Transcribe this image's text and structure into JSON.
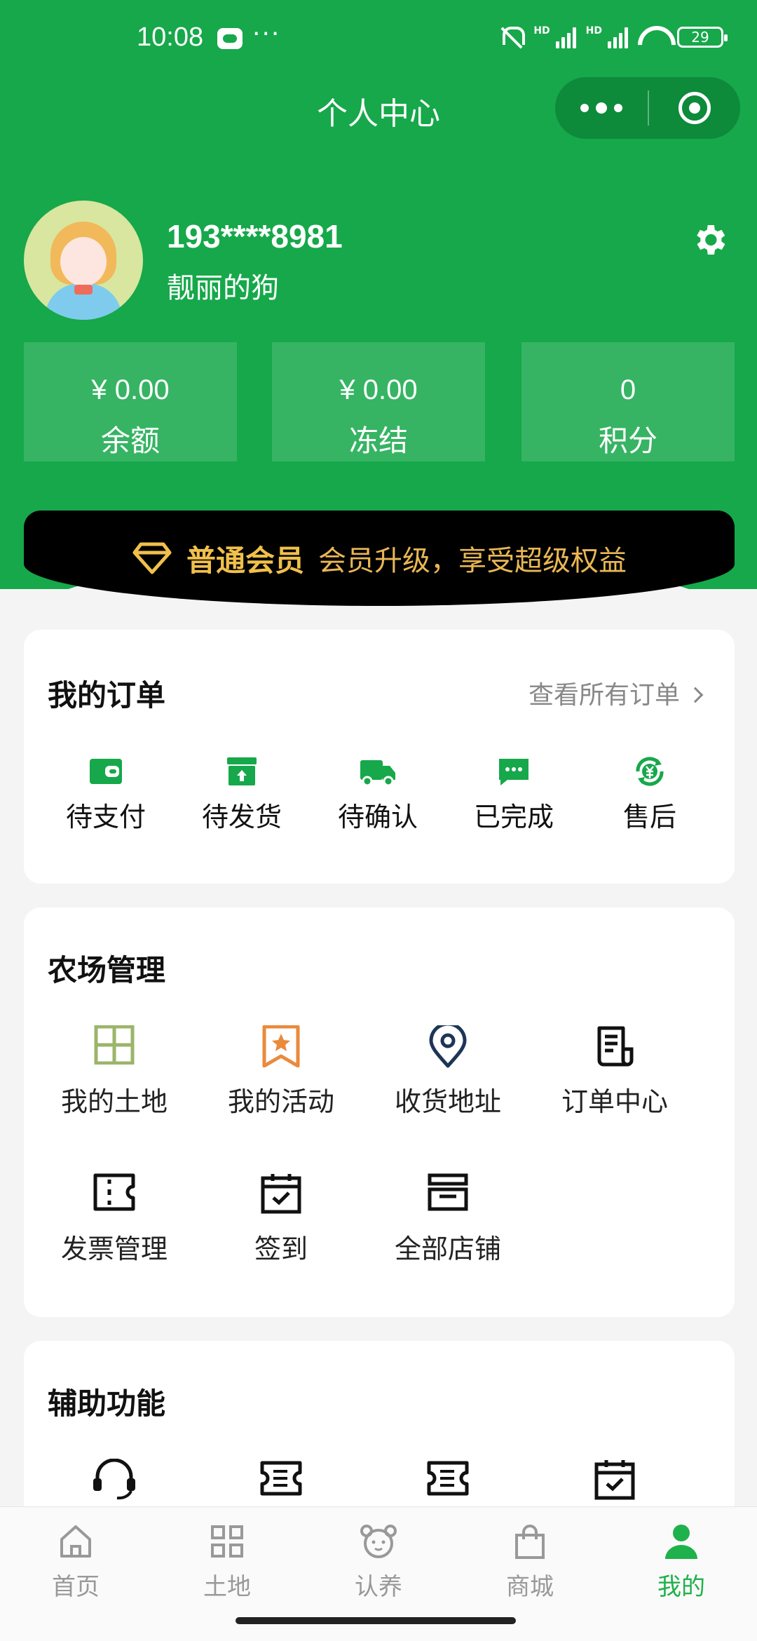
{
  "status_bar": {
    "time": "10:08",
    "dots": "···",
    "hd1": "HD",
    "hd2": "HD",
    "battery": "29"
  },
  "nav": {
    "title": "个人中心"
  },
  "profile": {
    "phone": "193****8981",
    "nickname": "靓丽的狗"
  },
  "stats": [
    {
      "value": "¥ 0.00",
      "label": "余额"
    },
    {
      "value": "¥ 0.00",
      "label": "冻结"
    },
    {
      "value": "0",
      "label": "积分"
    }
  ],
  "vip": {
    "tier": "普通会员",
    "promo": "会员升级，享受超级权益"
  },
  "orders": {
    "title": "我的订单",
    "view_all": "查看所有订单",
    "items": [
      {
        "label": "待支付",
        "icon": "wallet-icon"
      },
      {
        "label": "待发货",
        "icon": "box-icon"
      },
      {
        "label": "待确认",
        "icon": "truck-icon"
      },
      {
        "label": "已完成",
        "icon": "chat-icon"
      },
      {
        "label": "售后",
        "icon": "yuan-refresh-icon"
      }
    ]
  },
  "farm": {
    "title": "农场管理",
    "items": [
      {
        "label": "我的土地",
        "icon": "land-grid-icon"
      },
      {
        "label": "我的活动",
        "icon": "bookmark-star-icon"
      },
      {
        "label": "收货地址",
        "icon": "location-pin-icon"
      },
      {
        "label": "订单中心",
        "icon": "document-icon"
      },
      {
        "label": "发票管理",
        "icon": "ticket-icon"
      },
      {
        "label": "签到",
        "icon": "calendar-check-icon"
      },
      {
        "label": "全部店铺",
        "icon": "store-icon"
      }
    ]
  },
  "aux": {
    "title": "辅助功能",
    "items": [
      {
        "icon": "headset-icon"
      },
      {
        "icon": "coupon-icon"
      },
      {
        "icon": "coupon-icon"
      },
      {
        "icon": "calendar-check-icon"
      }
    ]
  },
  "tabbar": [
    {
      "label": "首页",
      "icon": "home-icon"
    },
    {
      "label": "土地",
      "icon": "grid-icon"
    },
    {
      "label": "认养",
      "icon": "bear-icon"
    },
    {
      "label": "商城",
      "icon": "shopping-bag-icon"
    },
    {
      "label": "我的",
      "icon": "user-icon",
      "active": true
    }
  ],
  "colors": {
    "brand_green": "#16a84a",
    "icon_green": "#16a84a",
    "vip_gold": "#f0c04b",
    "tab_active": "#1fb14b"
  }
}
